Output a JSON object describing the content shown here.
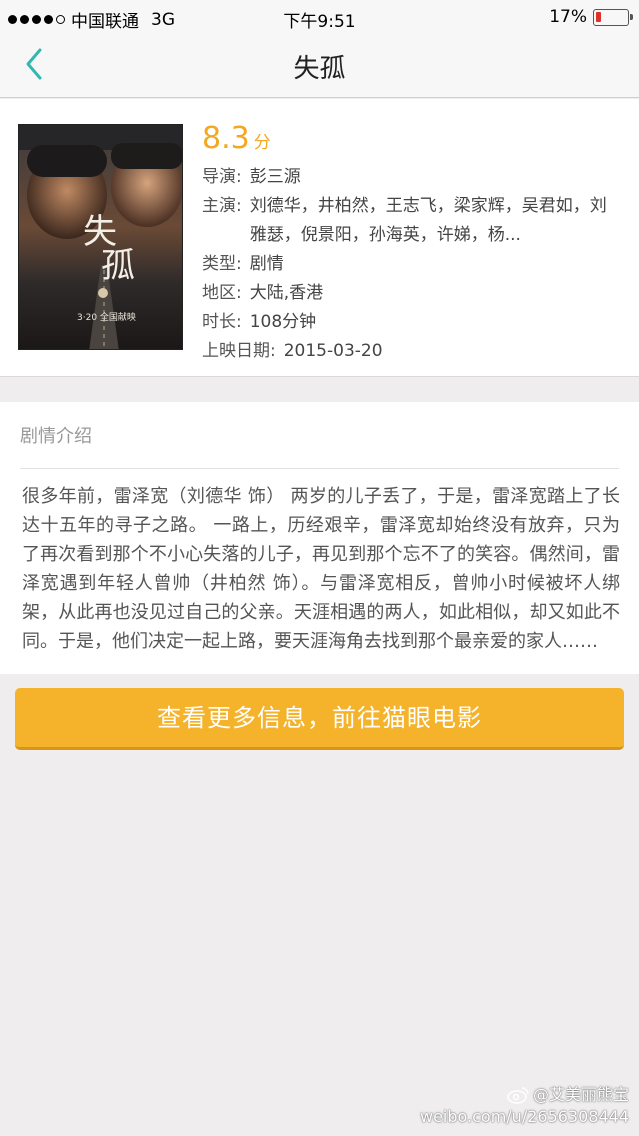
{
  "status_bar": {
    "carrier": "中国联通",
    "network": "3G",
    "time": "下午9:51",
    "battery_percent": "17%",
    "battery_level": 0.17,
    "battery_color": "#e0302a"
  },
  "nav": {
    "title": "失孤",
    "back_icon": "chevron-left-icon",
    "accent_color": "#33b7b0"
  },
  "movie": {
    "rating_value": "8.3",
    "rating_unit": "分",
    "director_label": "导演:",
    "director": "彭三源",
    "cast_label": "主演:",
    "cast": "刘德华，井柏然，王志飞，梁家辉，吴君如，刘雅瑟，倪景阳，孙海英，许娣，杨...",
    "genre_label": "类型:",
    "genre": "剧情",
    "region_label": "地区:",
    "region": "大陆,香港",
    "duration_label": "时长:",
    "duration": "108分钟",
    "release_label": "上映日期:",
    "release_date": "2015-03-20",
    "poster": {
      "title_char_1": "失",
      "title_char_2": "孤",
      "release_text": "3·20 全国献映"
    }
  },
  "synopsis": {
    "heading": "剧情介绍",
    "text": "很多年前，雷泽宽（刘德华 饰） 两岁的儿子丢了，于是，雷泽宽踏上了长达十五年的寻子之路。 一路上，历经艰辛，雷泽宽却始终没有放弃，只为了再次看到那个不小心失落的儿子，再见到那个忘不了的笑容。偶然间，雷泽宽遇到年轻人曾帅（井柏然 饰）。与雷泽宽相反，曾帅小时候被坏人绑架，从此再也没见过自己的父亲。天涯相遇的两人，如此相似，却又如此不同。于是，他们决定一起上路，要天涯海角去找到那个最亲爱的家人……"
  },
  "action": {
    "label": "查看更多信息，前往猫眼电影",
    "color": "#f5b22b"
  },
  "watermark": {
    "user": "@艾美丽熊宝",
    "url": "weibo.com/u/2656308444"
  }
}
